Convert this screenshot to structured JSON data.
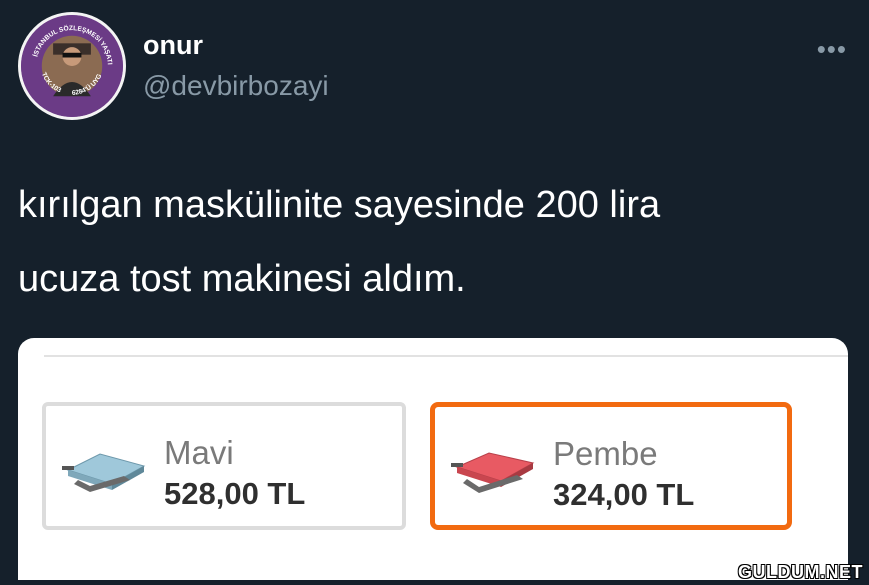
{
  "user": {
    "display_name": "onur",
    "handle": "@devbirbozayi",
    "avatar_badge": {
      "top_text": "İSTANBUL SÖZLEŞMESİ YAŞATIR",
      "left_text": "TCK-103",
      "bottom_text": "6284'Ü UYGULA"
    }
  },
  "more_label": "•••",
  "tweet": {
    "line1": "kırılgan maskülinite sayesinde 200 lira",
    "line2": "ucuza tost makinesi aldım."
  },
  "options": [
    {
      "name": "Mavi",
      "price": "528,00 TL",
      "color": "#9fc8da",
      "selected": false
    },
    {
      "name": "Pembe",
      "price": "324,00 TL",
      "color": "#e85a63",
      "selected": true
    }
  ],
  "colors": {
    "background": "#15202b",
    "selected_border": "#f26a10",
    "badge": "#6b3b86"
  },
  "watermark": "GULDUM.NET"
}
